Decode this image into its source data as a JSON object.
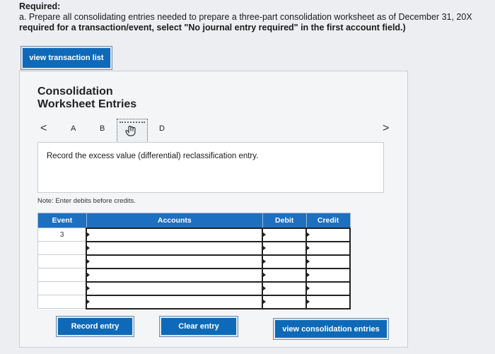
{
  "required": {
    "title": "Required:",
    "line1": "a. Prepare all consolidating entries needed to prepare a three-part consolidation worksheet as of December 31, 20X",
    "line2": "required for a transaction/event, select \"No journal entry required\" in the first account field.)"
  },
  "buttons": {
    "view_transaction_list": "view transaction list",
    "record_entry": "Record entry",
    "clear_entry": "Clear entry",
    "view_consolidation_entries": "view consolidation entries"
  },
  "panel": {
    "title_line1": "Consolidation",
    "title_line2": "Worksheet Entries",
    "tabs": {
      "prev": "<",
      "a": "A",
      "b": "B",
      "d": "D",
      "next": ">"
    },
    "instruction": "Record the excess value (differential) reclassification entry.",
    "note": "Note: Enter debits before credits."
  },
  "table": {
    "headers": {
      "event": "Event",
      "accounts": "Accounts",
      "debit": "Debit",
      "credit": "Credit"
    },
    "rows": [
      {
        "event": "3"
      },
      {
        "event": ""
      },
      {
        "event": ""
      },
      {
        "event": ""
      },
      {
        "event": ""
      },
      {
        "event": ""
      }
    ]
  },
  "icons": {
    "active_tab": "hand-pointer-icon"
  }
}
